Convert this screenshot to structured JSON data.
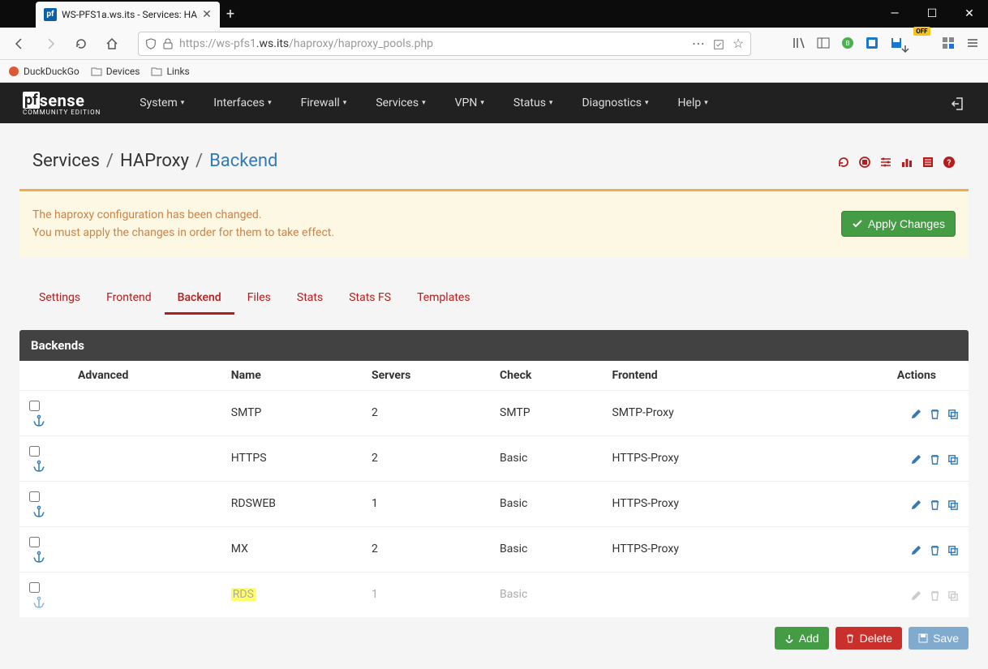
{
  "browser": {
    "tab_title": "WS-PFS1a.ws.its - Services: HA",
    "url_prefix": "https://",
    "url_gray1": "ws-pfs1",
    "url_dark": ".ws.its",
    "url_gray2": "/haproxy/haproxy_pools.php",
    "off_badge": "OFF"
  },
  "bookmarks": [
    {
      "label": "DuckDuckGo",
      "icon": "duck"
    },
    {
      "label": "Devices",
      "icon": "folder"
    },
    {
      "label": "Links",
      "icon": "folder"
    }
  ],
  "pf_nav": [
    "System",
    "Interfaces",
    "Firewall",
    "Services",
    "VPN",
    "Status",
    "Diagnostics",
    "Help"
  ],
  "logo_edition": "COMMUNITY EDITION",
  "breadcrumb": {
    "a": "Services",
    "b": "HAProxy",
    "c": "Backend"
  },
  "alert": {
    "line1": "The haproxy configuration has been changed.",
    "line2": "You must apply the changes in order for them to take effect.",
    "button": "Apply Changes"
  },
  "tabs": [
    {
      "label": "Settings",
      "active": false
    },
    {
      "label": "Frontend",
      "active": false
    },
    {
      "label": "Backend",
      "active": true
    },
    {
      "label": "Files",
      "active": false
    },
    {
      "label": "Stats",
      "active": false
    },
    {
      "label": "Stats FS",
      "active": false
    },
    {
      "label": "Templates",
      "active": false
    }
  ],
  "panel_title": "Backends",
  "columns": {
    "advanced": "Advanced",
    "name": "Name",
    "servers": "Servers",
    "check": "Check",
    "frontend": "Frontend",
    "actions": "Actions"
  },
  "rows": [
    {
      "name": "SMTP",
      "servers": "2",
      "check": "SMTP",
      "frontend": "SMTP-Proxy",
      "disabled": false,
      "highlight": false
    },
    {
      "name": "HTTPS",
      "servers": "2",
      "check": "Basic",
      "frontend": "HTTPS-Proxy",
      "disabled": false,
      "highlight": false
    },
    {
      "name": "RDSWEB",
      "servers": "1",
      "check": "Basic",
      "frontend": "HTTPS-Proxy",
      "disabled": false,
      "highlight": false
    },
    {
      "name": "MX",
      "servers": "2",
      "check": "Basic",
      "frontend": "HTTPS-Proxy",
      "disabled": false,
      "highlight": false
    },
    {
      "name": "RDS",
      "servers": "1",
      "check": "Basic",
      "frontend": "",
      "disabled": true,
      "highlight": true
    }
  ],
  "footer": {
    "add": "Add",
    "delete": "Delete",
    "save": "Save"
  }
}
